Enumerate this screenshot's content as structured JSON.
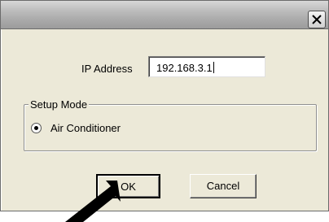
{
  "titlebar": {
    "close_icon": "close-icon"
  },
  "ip": {
    "label": "IP Address",
    "value": "192.168.3.1"
  },
  "setup_mode": {
    "legend": "Setup Mode",
    "option_label": "Air Conditioner",
    "option_selected": true
  },
  "buttons": {
    "ok": "OK",
    "cancel": "Cancel"
  },
  "annotation": {
    "pointer": "arrow-icon"
  }
}
